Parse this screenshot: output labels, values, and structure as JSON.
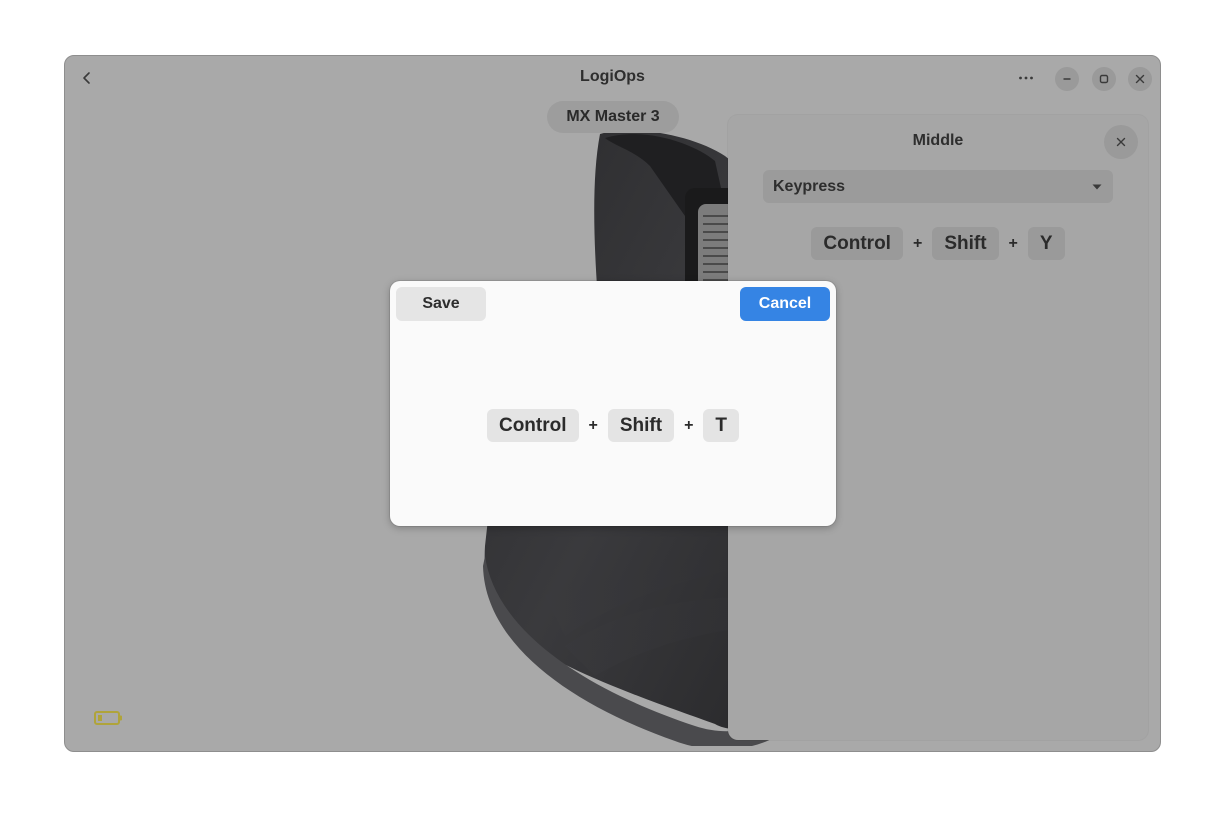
{
  "window": {
    "title": "LogiOps",
    "device_name": "MX Master 3"
  },
  "icons": {
    "back": "chevron-left-icon",
    "menu": "more-horizontal-icon",
    "minimize": "minimize-icon",
    "maximize": "maximize-icon",
    "close": "close-icon",
    "battery": "battery-low-icon",
    "dropdown": "triangle-down-icon"
  },
  "colors": {
    "battery": "#b0a43a",
    "accent": "#3584e4"
  },
  "panel": {
    "title": "Middle",
    "action_type": "Keypress",
    "shortcut": {
      "key1": "Control",
      "plus1": "+",
      "key2": "Shift",
      "plus2": "+",
      "key3": "Y"
    }
  },
  "dialog": {
    "save_label": "Save",
    "cancel_label": "Cancel",
    "shortcut": {
      "key1": "Control",
      "plus1": "+",
      "key2": "Shift",
      "plus2": "+",
      "key3": "T"
    }
  }
}
